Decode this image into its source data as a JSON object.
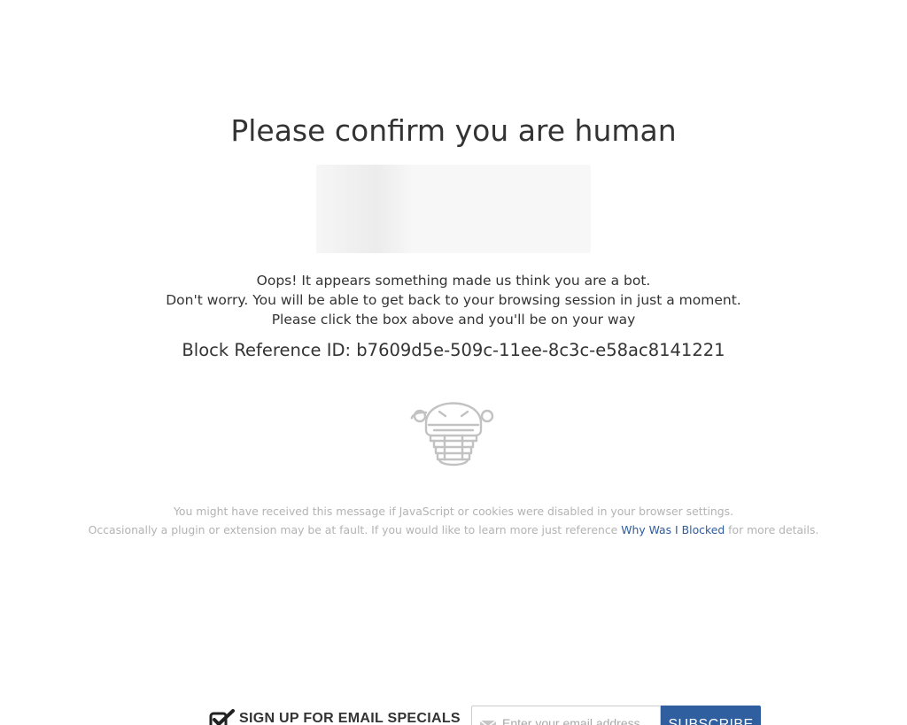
{
  "page": {
    "title": "Please confirm you are human"
  },
  "message": {
    "line1": "Oops! It appears something made us think you are a bot.",
    "line2": "Don't worry. You will be able to get back to your browsing session in just a moment.",
    "line3": "Please click the box above and you'll be on your way"
  },
  "reference": {
    "text": "Block Reference ID: b7609d5e-509c-11ee-8c3c-e58ac8141221"
  },
  "footnote": {
    "line1": "You might have received this message if JavaScript or cookies were disabled in your browser settings.",
    "line2_before": "Occasionally a plugin or extension may be at fault. If you would like to learn more just reference ",
    "link_text": "Why Was I Blocked",
    "line2_after": " for more details."
  },
  "signup": {
    "label": "SIGN UP FOR EMAIL SPECIALS",
    "email_placeholder": "Enter your email address",
    "subscribe_label": "SUBSCRIBE"
  },
  "colors": {
    "link": "#2d5b9c",
    "button": "#2f5f9e",
    "muted_text": "#b3b3b3",
    "icon_stroke": "#bdbdbd"
  },
  "icons": {
    "robot": "robot-icon",
    "check": "checkmark-icon",
    "mail": "envelope-icon"
  }
}
